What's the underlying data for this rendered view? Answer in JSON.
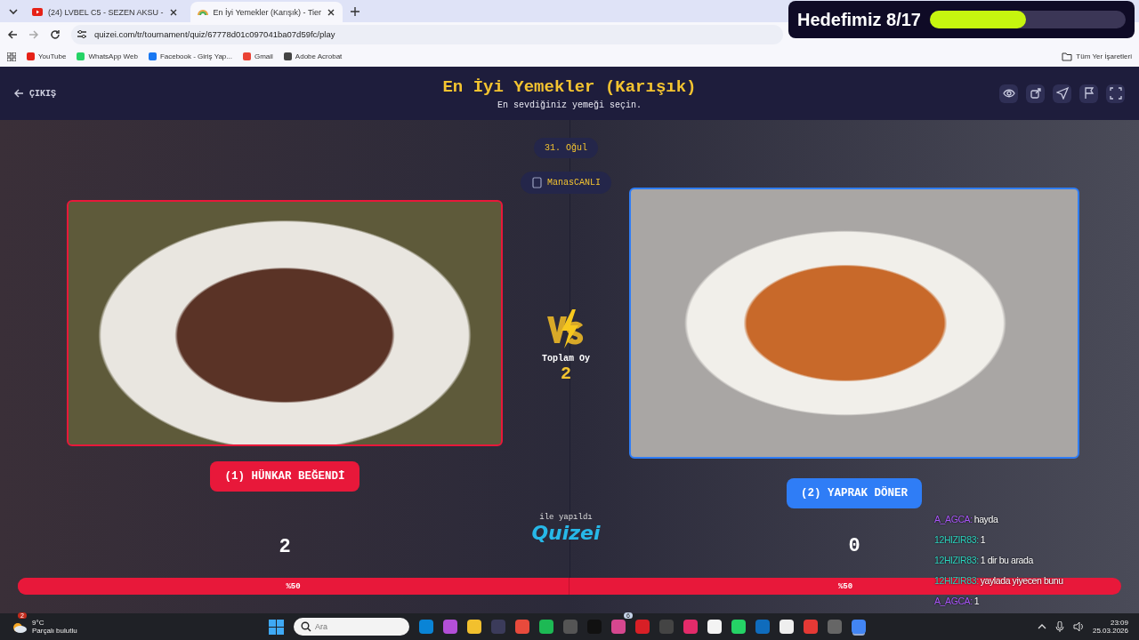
{
  "browser": {
    "tabs": [
      {
        "title": "(24) LVBEL C5 - SEZEN AKSU - ",
        "selected": false,
        "kind": "video"
      },
      {
        "title": "En İyi Yemekler (Karışık) - Tier",
        "selected": true,
        "kind": "quiz"
      }
    ],
    "url": "quizei.com/tr/tournament/quiz/67778d01c097041ba07d59fc/play",
    "bookmarks": [
      {
        "label": "YouTube",
        "color": "#e62117"
      },
      {
        "label": "WhatsApp Web",
        "color": "#25d366"
      },
      {
        "label": "Facebook - Giriş Yap...",
        "color": "#1877f2"
      },
      {
        "label": "Gmail",
        "color": "#ea4335"
      },
      {
        "label": "Adobe Acrobat",
        "color": "#444444"
      }
    ],
    "all_bookmarks": "Tüm Yer İşaretleri"
  },
  "goal": {
    "label": "Hedefimiz 8/17",
    "level": 0.49
  },
  "app": {
    "exit": "ÇIKIŞ",
    "title": "En İyi Yemekler (Karışık)",
    "subtitle": "En sevdiğiniz yemeği seçin.",
    "round": "31. Oğul",
    "user": "ManasCANLI",
    "total_label": "Toplam Oy",
    "total": "2",
    "made_with": "ile yapıldı",
    "brand": "Quizei",
    "options": [
      {
        "label": "(1) HÜNKAR BEĞENDİ",
        "votes": "2",
        "percent": "%50",
        "color": "#e8183a"
      },
      {
        "label": "(2) YAPRAK DÖNER",
        "votes": "0",
        "percent": "%50",
        "color": "#2f7df6"
      }
    ],
    "vote_share": {
      "level": 0.5
    }
  },
  "chat": [
    {
      "user": "A_AGCA:",
      "text": "hayda",
      "color": "#a855f7"
    },
    {
      "user": "12HIZIR83:",
      "text": "1",
      "color": "#2dd4bf"
    },
    {
      "user": "12HIZIR83:",
      "text": "1 dir bu arada",
      "color": "#2dd4bf"
    },
    {
      "user": "12HIZIR83:",
      "text": "yaylada yiyecen bunu",
      "color": "#2dd4bf"
    },
    {
      "user": "A_AGCA:",
      "text": "1",
      "color": "#a855f7"
    }
  ],
  "taskbar": {
    "temperature": "9°C",
    "weather": "Parçalı bulutlu",
    "weather_badge": "2",
    "search_placeholder": "Ara",
    "apps": [
      {
        "color": "#0a84d6"
      },
      {
        "color": "#b34fd8"
      },
      {
        "color": "#f2c02e"
      },
      {
        "color": "#3b3b5a"
      },
      {
        "color": "#e84a3c"
      },
      {
        "color": "#1db954"
      },
      {
        "color": "#555555"
      },
      {
        "color": "#111111"
      },
      {
        "color": "#d6478f",
        "badge": "6"
      },
      {
        "color": "#d81f26"
      },
      {
        "color": "#444444"
      },
      {
        "color": "#e32b6a"
      },
      {
        "color": "#f3f3f3"
      },
      {
        "color": "#25d366"
      },
      {
        "color": "#0f6cbd"
      },
      {
        "color": "#eeeeee"
      },
      {
        "color": "#e53935"
      },
      {
        "color": "#666666"
      },
      {
        "color": "#4285f4",
        "selected": true
      }
    ],
    "time": "23:09",
    "date": "25.03.2026"
  }
}
